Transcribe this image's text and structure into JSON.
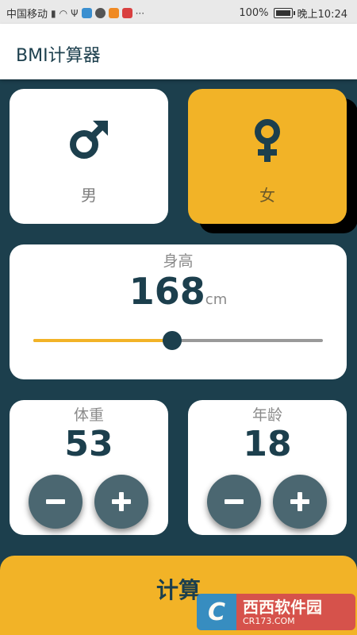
{
  "status_bar": {
    "carrier": "中国移动",
    "battery": "100%",
    "time": "晚上10:24"
  },
  "app_bar": {
    "title": "BMI计算器"
  },
  "gender": {
    "male_label": "男",
    "female_label": "女",
    "selected": "female"
  },
  "height": {
    "label": "身高",
    "value": "168",
    "unit": "cm",
    "slider_fraction": 0.48
  },
  "weight": {
    "label": "体重",
    "value": "53",
    "minus_label": "−",
    "plus_label": "+"
  },
  "age": {
    "label": "年龄",
    "value": "18",
    "minus_label": "−",
    "plus_label": "+"
  },
  "calculate": {
    "label": "计算"
  },
  "watermark": {
    "name": "西西软件园",
    "url": "CR173.COM"
  },
  "colors": {
    "primary_dark": "#1c3f4d",
    "accent": "#f2b327",
    "card": "#ffffff",
    "button": "#4b6771"
  }
}
